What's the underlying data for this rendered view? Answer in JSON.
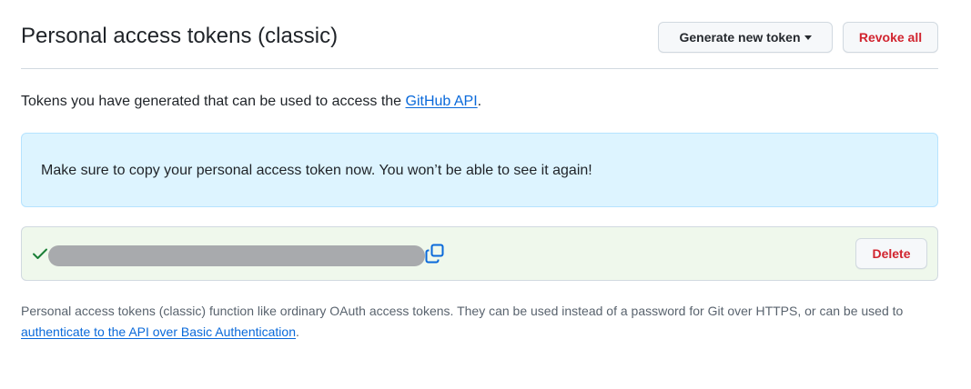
{
  "header": {
    "title": "Personal access tokens (classic)",
    "generate_label": "Generate new token",
    "revoke_label": "Revoke all"
  },
  "intro": {
    "text": "Tokens you have generated that can be used to access the ",
    "link_text": "GitHub API",
    "suffix": "."
  },
  "flash": {
    "message": "Make sure to copy your personal access token now. You won’t be able to see it again!"
  },
  "token": {
    "status_icon": "check-icon",
    "masked": true,
    "copy_icon": "copy-icon",
    "delete_label": "Delete"
  },
  "footer_note": {
    "text": "Personal access tokens (classic) function like ordinary OAuth access tokens. They can be used instead of a password for Git over HTTPS, or can be used to ",
    "link_text": "authenticate to the API over Basic Authentication",
    "suffix": "."
  },
  "colors": {
    "accent_link": "#0969da",
    "danger": "#d1242f",
    "success": "#1a7f37",
    "info_bg": "#ddf4ff",
    "success_bg": "#eff8ec"
  }
}
